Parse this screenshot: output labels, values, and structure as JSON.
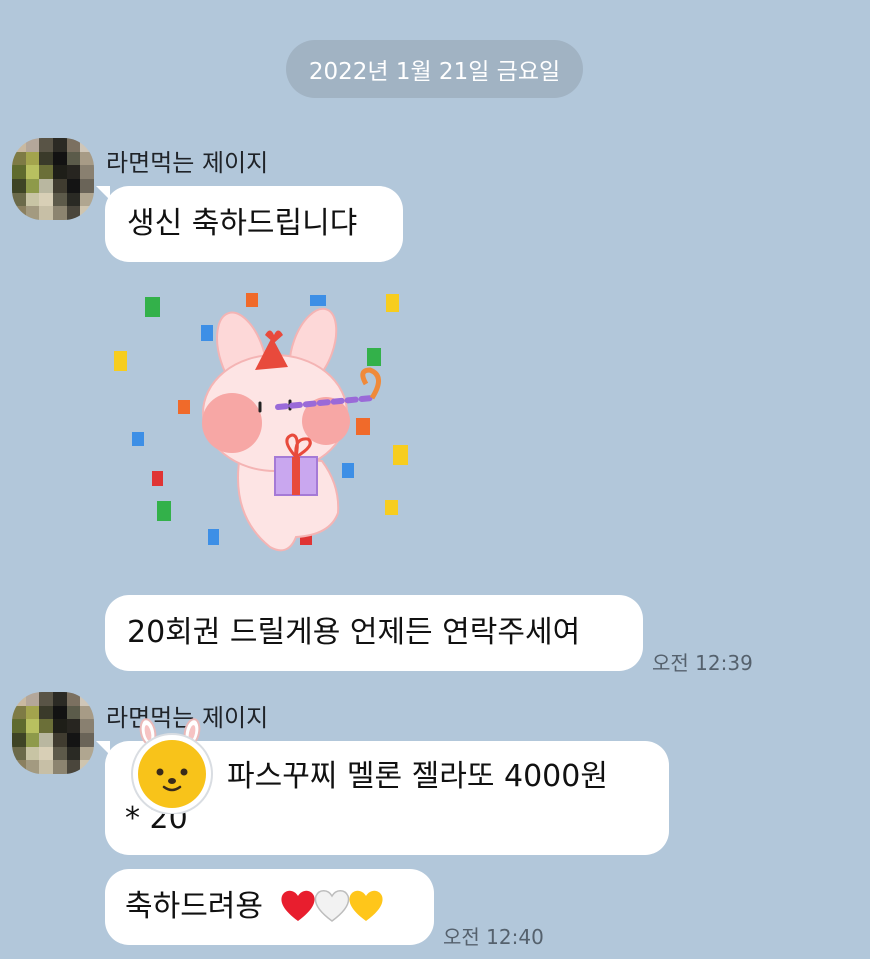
{
  "date_divider": "2022년 1월 21일 금요일",
  "groups": [
    {
      "sender": "라면먹는 제이지",
      "messages": [
        {
          "text": "생신 축하드립니댜"
        },
        {
          "text": "20회권 드릴게용 언제든 연락주세여",
          "time": "오전 12:39"
        }
      ]
    },
    {
      "sender": "라면먹는 제이지",
      "messages": [
        {
          "line1": "파스꾸찌 멜론 젤라또 4000원",
          "line2": "* 20"
        },
        {
          "text": "축하드려용",
          "time": "오전 12:40"
        }
      ]
    }
  ],
  "icons": [
    "pixelated-avatar",
    "birthday-bunny-sticker",
    "bear-emoticon",
    "red-heart-emoji",
    "white-heart-emoji",
    "yellow-heart-emoji"
  ],
  "colors": {
    "background": "#b2c7da",
    "bubble": "#ffffff",
    "date_pill": "#a1b3c3"
  }
}
